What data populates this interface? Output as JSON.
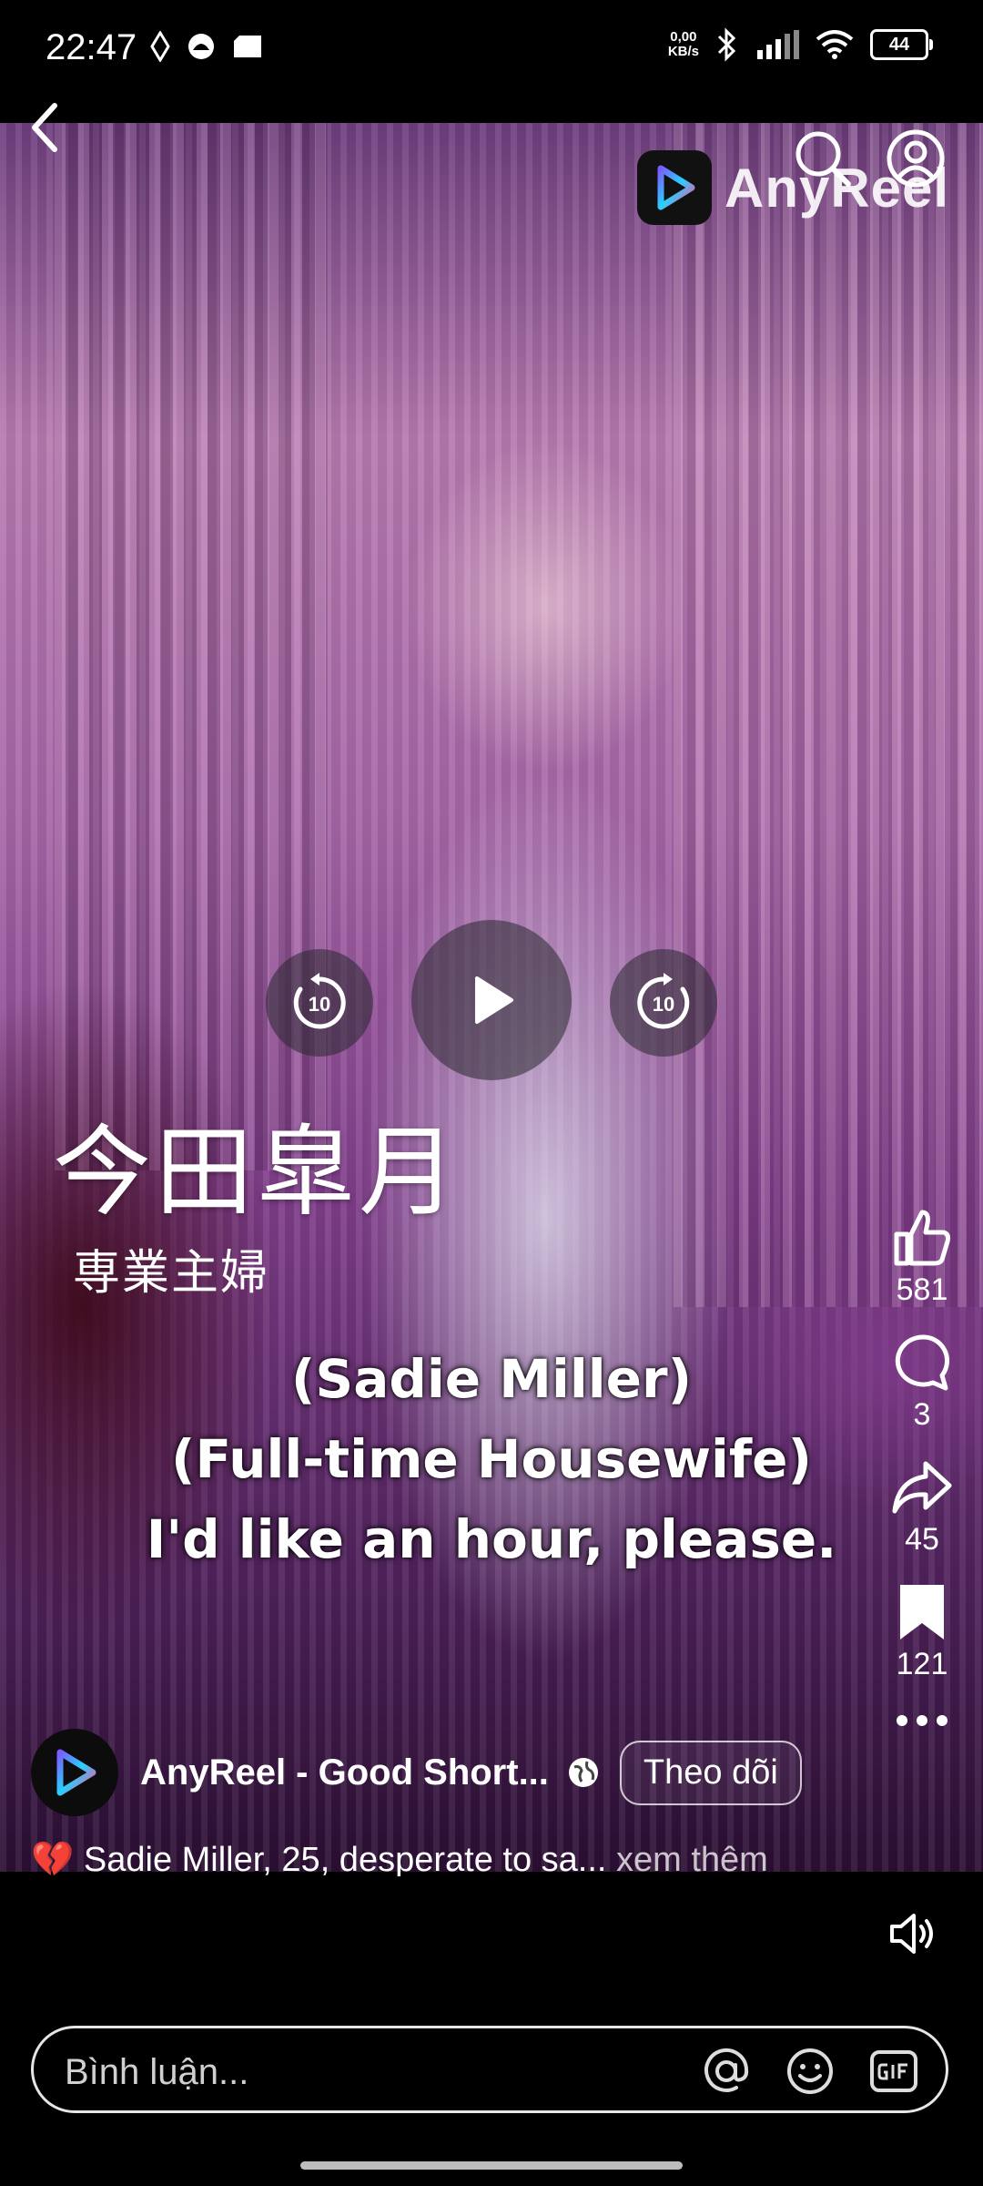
{
  "status_bar": {
    "time": "22:47",
    "net_speed_value": "0,00",
    "net_speed_unit": "KB/s",
    "battery": "44"
  },
  "header": {
    "brand_name": "AnyReel"
  },
  "video": {
    "name_overlay": "今田皐月",
    "role_overlay": "専業主婦",
    "subtitles": [
      "(Sadie Miller)",
      "(Full-time Housewife)",
      "I'd like an hour, please."
    ],
    "rewind_seconds": "10",
    "forward_seconds": "10"
  },
  "actions": {
    "likes": "581",
    "comments": "3",
    "shares": "45",
    "saves": "121"
  },
  "author": {
    "name": "AnyReel - Good Short...",
    "follow_label": "Theo dõi"
  },
  "caption": {
    "emoji": "💔",
    "text": "Sadie Miller, 25, desperate to sa...",
    "see_more": "xem thêm"
  },
  "comment_bar": {
    "placeholder": "Bình luận..."
  }
}
